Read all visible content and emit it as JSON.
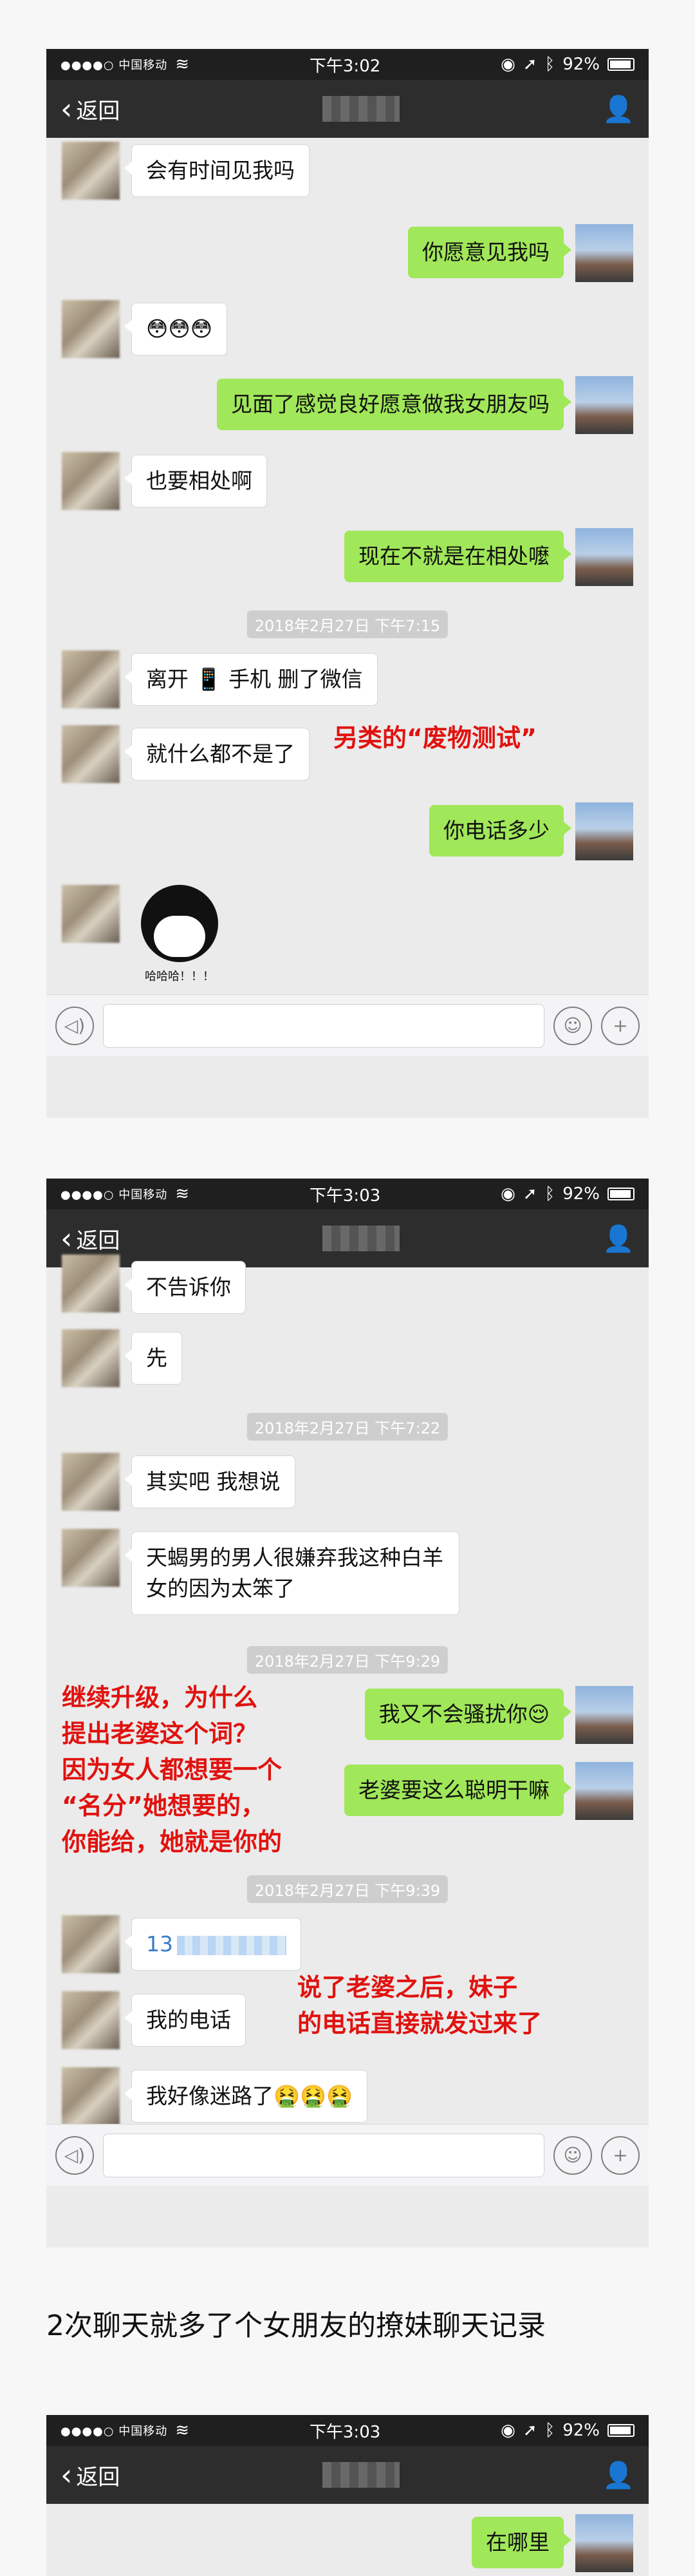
{
  "screens": [
    {
      "status": {
        "carrier": "●●●●○ 中国移动",
        "time": "下午3:02",
        "battery": "92%"
      },
      "nav": {
        "back_label": "返回"
      },
      "messages": [
        {
          "side": "left",
          "text": "会有时间见我吗"
        },
        {
          "side": "right",
          "text": "你愿意见我吗"
        },
        {
          "side": "left",
          "text": "😳😳😳"
        },
        {
          "side": "right",
          "text": "见面了感觉良好愿意做我女朋友吗"
        },
        {
          "side": "left",
          "text": "也要相处啊"
        },
        {
          "side": "right",
          "text": "现在不就是在相处嚒"
        },
        {
          "type": "time",
          "text": "2018年2月27日 下午7:15"
        },
        {
          "side": "left",
          "text": "离开 📱 手机 删了微信"
        },
        {
          "side": "left",
          "text": "就什么都不是了"
        },
        {
          "side": "right",
          "text": "你电话多少"
        },
        {
          "side": "left",
          "type": "sticker",
          "caption": "哈哈哈！！！"
        }
      ],
      "notes": [
        "另类的“废物测试”"
      ]
    },
    {
      "status": {
        "carrier": "●●●●○ 中国移动",
        "time": "下午3:03",
        "battery": "92%"
      },
      "nav": {
        "back_label": "返回"
      },
      "messages": [
        {
          "side": "left",
          "text": "不告诉你"
        },
        {
          "side": "left",
          "text": "先"
        },
        {
          "type": "time",
          "text": "2018年2月27日 下午7:22"
        },
        {
          "side": "left",
          "text": "其实吧 我想说"
        },
        {
          "side": "left",
          "text": "天蝎男的男人很嫌弃我这种白羊女的因为太笨了"
        },
        {
          "type": "time",
          "text": "2018年2月27日 下午9:29"
        },
        {
          "side": "right",
          "text": "我又不会骚扰你😌"
        },
        {
          "side": "right",
          "text": "老婆要这么聪明干嘛"
        },
        {
          "type": "time",
          "text": "2018年2月27日 下午9:39"
        },
        {
          "side": "left",
          "text": "13"
        },
        {
          "side": "left",
          "text": "我的电话"
        },
        {
          "side": "left",
          "text": "我好像迷路了🤮🤮🤮"
        }
      ],
      "notes": [
        "继续升级，为什么",
        "提出老婆这个词？",
        "因为女人都想要一个",
        "“名分”她想要的，",
        "你能给，她就是你的",
        "说了老婆之后，妹子",
        "的电话直接就发过来了"
      ]
    },
    {
      "status": {
        "carrier": "●●●●○ 中国移动",
        "time": "下午3:03",
        "battery": "92%"
      },
      "nav": {
        "back_label": "返回"
      },
      "messages": [
        {
          "side": "right",
          "text": "在哪里"
        }
      ]
    }
  ],
  "caption": "2次聊天就多了个女朋友的撩妹聊天记录",
  "colors": {
    "bubble_green": "#a0e759",
    "note_red": "#e0120f",
    "nav_bg": "#2d2d2d"
  }
}
